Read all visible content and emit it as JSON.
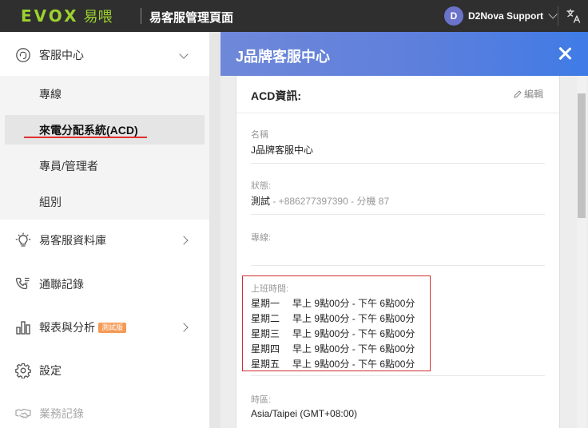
{
  "topbar": {
    "logo_text": "EVOX",
    "logo_zh": "易喂",
    "app_title": "易客服管理頁面",
    "user_initial": "D",
    "user_name": "D2Nova Support"
  },
  "sidebar": {
    "items": [
      {
        "label": "客服中心",
        "icon": "headset-icon",
        "expanded": true
      },
      {
        "label": "易客服資料庫",
        "icon": "lightbulb-icon"
      },
      {
        "label": "通聯記錄",
        "icon": "phone-log-icon"
      },
      {
        "label": "報表與分析",
        "icon": "bar-chart-icon",
        "badge": "測試版"
      },
      {
        "label": "設定",
        "icon": "gear-icon"
      },
      {
        "label": "業務記錄",
        "icon": "handshake-icon"
      }
    ],
    "subitems": [
      {
        "label": "專線"
      },
      {
        "label": "來電分配系統(ACD)",
        "active": true
      },
      {
        "label": "專員/管理者"
      },
      {
        "label": "組別"
      }
    ]
  },
  "panel": {
    "title": "J品牌客服中心",
    "card_title": "ACD資訊:",
    "edit_label": "編輯",
    "name_label": "名稱",
    "name_value": "J品牌客服中心",
    "status_label": "狀態:",
    "status_value": "測試",
    "status_detail": " - +886277397390 - 分機 87",
    "line_label": "專線:",
    "line_value": "",
    "hours_label": "上班時間:",
    "hours": [
      {
        "day": "星期一",
        "time": "早上 9點00分 - 下午 6點00分"
      },
      {
        "day": "星期二",
        "time": "早上 9點00分 - 下午 6點00分"
      },
      {
        "day": "星期三",
        "time": "早上 9點00分 - 下午 6點00分"
      },
      {
        "day": "星期四",
        "time": "早上 9點00分 - 下午 6點00分"
      },
      {
        "day": "星期五",
        "time": "早上 9點00分 - 下午 6點00分"
      }
    ],
    "timezone_label": "時區:",
    "timezone_value": "Asia/Taipei (GMT+08:00)"
  },
  "colors": {
    "topbar_bg": "#2f2f2f",
    "logo_green": "#9bd12e",
    "header_blue": "#5d7fdc",
    "highlight_red": "#d0302f",
    "badge_orange": "#f59a55"
  }
}
